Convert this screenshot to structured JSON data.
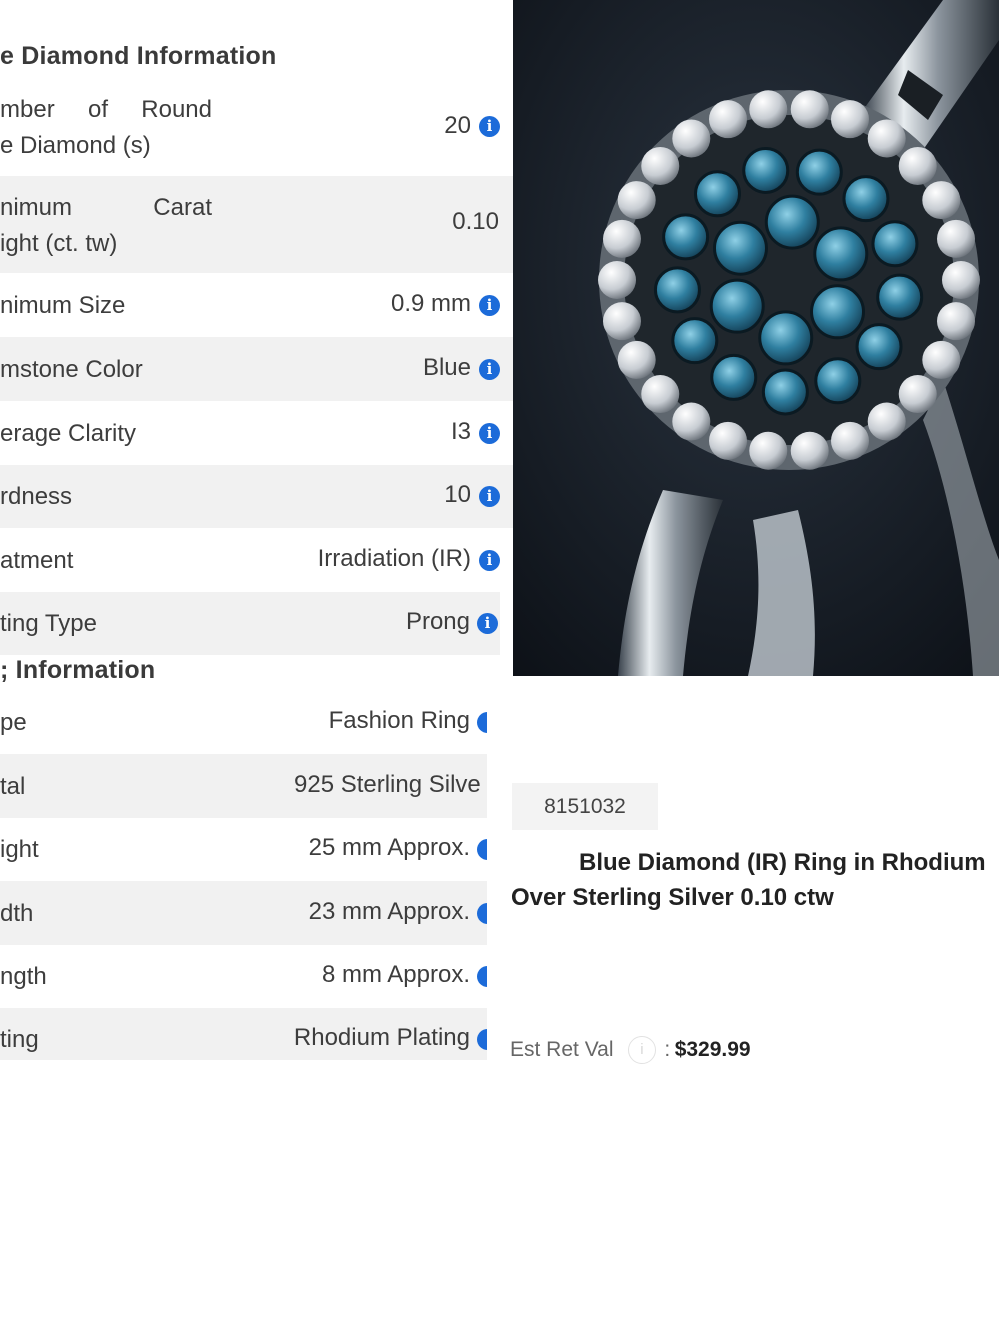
{
  "diamond_section": {
    "title": "e Diamond Information",
    "rows": [
      {
        "label_l1": "mber of Round",
        "label_l2": "e Diamond (s)",
        "value": "20",
        "icon": "info-icon"
      },
      {
        "label_l1": "nimum Carat",
        "label_l2": "ight (ct. tw)",
        "value": "0.10",
        "icon": ""
      },
      {
        "label": "nimum Size",
        "value": "0.9 mm",
        "icon": "info-icon"
      },
      {
        "label": "mstone Color",
        "value": "Blue",
        "icon": "info-icon"
      },
      {
        "label": "erage Clarity",
        "value": "I3",
        "icon": "info-icon"
      },
      {
        "label": "rdness",
        "value": "10",
        "icon": "info-icon"
      },
      {
        "label": "atment",
        "value": "Irradiation (IR)",
        "icon": "info-icon"
      },
      {
        "label": "ting Type",
        "value": "Prong",
        "icon": "info-icon"
      }
    ]
  },
  "ring_section": {
    "title": "; Information",
    "rows": [
      {
        "label": "pe",
        "value": "Fashion Ring"
      },
      {
        "label": "tal",
        "value": "925 Sterling Silve"
      },
      {
        "label": "ight",
        "value": "25 mm Approx."
      },
      {
        "label": "dth",
        "value": "23 mm Approx."
      },
      {
        "label": "ngth",
        "value": "8 mm Approx."
      },
      {
        "label": "ting",
        "value": "Rhodium Plating"
      }
    ]
  },
  "product": {
    "sku": "8151032",
    "title_line1": "Blue Diamond (IR) Ring in Rhodium",
    "title_line2": "Over Sterling Silver 0.10 ctw",
    "retail_label": "Est Ret Val",
    "retail_colon": ":",
    "retail_price": "$329.99",
    "image_subject": "ring-photo"
  },
  "colors": {
    "info_icon": "#1c6bd9",
    "row_shade": "#f1f1f1"
  }
}
